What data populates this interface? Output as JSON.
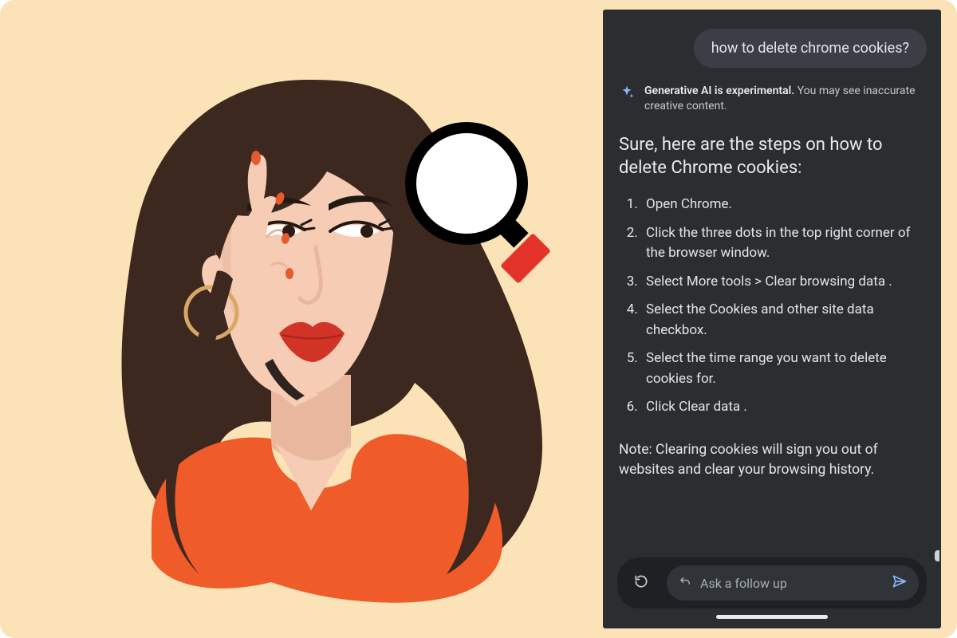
{
  "query": "how to delete chrome cookies?",
  "notice": {
    "bold": "Generative AI is experimental.",
    "rest": " You may see inaccurate creative content."
  },
  "answer": {
    "title": "Sure, here are the steps on how to delete Chrome cookies:",
    "steps": [
      "Open Chrome.",
      "Click the three dots in the top right corner of the browser window.",
      "Select More tools > Clear browsing data .",
      "Select the Cookies and other site data checkbox.",
      "Select the time range you want to delete cookies for.",
      "Click Clear data ."
    ],
    "note": "Note: Clearing cookies will sign you out of websites and clear your browsing history."
  },
  "followup": {
    "placeholder": "Ask a follow up"
  },
  "colors": {
    "canvas": "#fbe3b7",
    "phone_bg": "#2b2d31",
    "bubble_bg": "#3b3f45",
    "accent_send": "#8ab4f8",
    "magnifier_handle": "#e43328",
    "shirt": "#f05b2a",
    "hair": "#3d281f",
    "skin": "#f6ccb5",
    "skin_shadow": "#e9b79d",
    "lips": "#d13326",
    "nails": "#e65a2e",
    "eyebrow": "#231812"
  },
  "icons": {
    "sparkle": "sparkle-icon",
    "reload": "reload-icon",
    "reply": "reply-arrow-icon",
    "send": "send-icon",
    "magnifier": "magnifying-glass-icon"
  }
}
